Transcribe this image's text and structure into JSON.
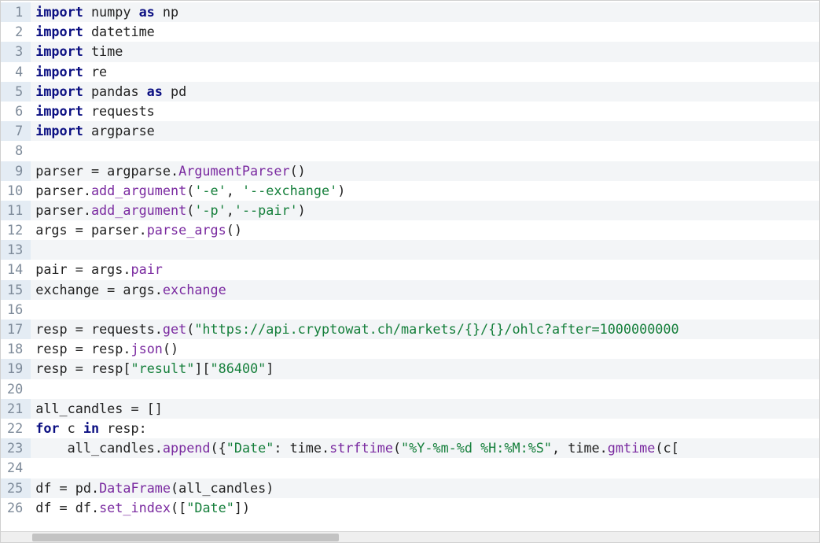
{
  "editor": {
    "lines": [
      {
        "n": 1,
        "tokens": [
          [
            "kw",
            "import"
          ],
          [
            "nm",
            " numpy "
          ],
          [
            "as",
            "as"
          ],
          [
            "nm",
            " np"
          ]
        ]
      },
      {
        "n": 2,
        "tokens": [
          [
            "kw",
            "import"
          ],
          [
            "nm",
            " datetime"
          ]
        ]
      },
      {
        "n": 3,
        "tokens": [
          [
            "kw",
            "import"
          ],
          [
            "nm",
            " time"
          ]
        ]
      },
      {
        "n": 4,
        "tokens": [
          [
            "kw",
            "import"
          ],
          [
            "nm",
            " re"
          ]
        ]
      },
      {
        "n": 5,
        "tokens": [
          [
            "kw",
            "import"
          ],
          [
            "nm",
            " pandas "
          ],
          [
            "as",
            "as"
          ],
          [
            "nm",
            " pd"
          ]
        ]
      },
      {
        "n": 6,
        "tokens": [
          [
            "kw",
            "import"
          ],
          [
            "nm",
            " requests"
          ]
        ]
      },
      {
        "n": 7,
        "tokens": [
          [
            "kw",
            "import"
          ],
          [
            "nm",
            " argparse"
          ]
        ]
      },
      {
        "n": 8,
        "tokens": []
      },
      {
        "n": 9,
        "tokens": [
          [
            "nm",
            "parser "
          ],
          [
            "op",
            "= "
          ],
          [
            "nm",
            "argparse"
          ],
          [
            "op",
            "."
          ],
          [
            "fn",
            "ArgumentParser"
          ],
          [
            "op",
            "()"
          ]
        ]
      },
      {
        "n": 10,
        "tokens": [
          [
            "nm",
            "parser"
          ],
          [
            "op",
            "."
          ],
          [
            "fn",
            "add_argument"
          ],
          [
            "op",
            "("
          ],
          [
            "str",
            "'-e'"
          ],
          [
            "op",
            ", "
          ],
          [
            "str",
            "'--exchange'"
          ],
          [
            "op",
            ")"
          ]
        ]
      },
      {
        "n": 11,
        "tokens": [
          [
            "nm",
            "parser"
          ],
          [
            "op",
            "."
          ],
          [
            "fn",
            "add_argument"
          ],
          [
            "op",
            "("
          ],
          [
            "str",
            "'-p'"
          ],
          [
            "op",
            ","
          ],
          [
            "str",
            "'--pair'"
          ],
          [
            "op",
            ")"
          ]
        ]
      },
      {
        "n": 12,
        "tokens": [
          [
            "nm",
            "args "
          ],
          [
            "op",
            "= "
          ],
          [
            "nm",
            "parser"
          ],
          [
            "op",
            "."
          ],
          [
            "fn",
            "parse_args"
          ],
          [
            "op",
            "()"
          ]
        ]
      },
      {
        "n": 13,
        "tokens": []
      },
      {
        "n": 14,
        "tokens": [
          [
            "nm",
            "pair "
          ],
          [
            "op",
            "= "
          ],
          [
            "nm",
            "args"
          ],
          [
            "op",
            "."
          ],
          [
            "fn",
            "pair"
          ]
        ]
      },
      {
        "n": 15,
        "tokens": [
          [
            "nm",
            "exchange "
          ],
          [
            "op",
            "= "
          ],
          [
            "nm",
            "args"
          ],
          [
            "op",
            "."
          ],
          [
            "fn",
            "exchange"
          ]
        ]
      },
      {
        "n": 16,
        "tokens": []
      },
      {
        "n": 17,
        "tokens": [
          [
            "nm",
            "resp "
          ],
          [
            "op",
            "= "
          ],
          [
            "nm",
            "requests"
          ],
          [
            "op",
            "."
          ],
          [
            "fn",
            "get"
          ],
          [
            "op",
            "("
          ],
          [
            "str",
            "\"https://api.cryptowat.ch/markets/{}/{}/ohlc?after=1000000000"
          ]
        ]
      },
      {
        "n": 18,
        "tokens": [
          [
            "nm",
            "resp "
          ],
          [
            "op",
            "= "
          ],
          [
            "nm",
            "resp"
          ],
          [
            "op",
            "."
          ],
          [
            "fn",
            "json"
          ],
          [
            "op",
            "()"
          ]
        ]
      },
      {
        "n": 19,
        "tokens": [
          [
            "nm",
            "resp "
          ],
          [
            "op",
            "= "
          ],
          [
            "nm",
            "resp"
          ],
          [
            "op",
            "["
          ],
          [
            "str",
            "\"result\""
          ],
          [
            "op",
            "]["
          ],
          [
            "str",
            "\"86400\""
          ],
          [
            "op",
            "]"
          ]
        ]
      },
      {
        "n": 20,
        "tokens": []
      },
      {
        "n": 21,
        "tokens": [
          [
            "nm",
            "all_candles "
          ],
          [
            "op",
            "= []"
          ]
        ]
      },
      {
        "n": 22,
        "tokens": [
          [
            "kw",
            "for"
          ],
          [
            "nm",
            " c "
          ],
          [
            "kw",
            "in"
          ],
          [
            "nm",
            " resp"
          ],
          [
            "op",
            ":"
          ]
        ]
      },
      {
        "n": 23,
        "tokens": [
          [
            "nm",
            "    all_candles"
          ],
          [
            "op",
            "."
          ],
          [
            "fn",
            "append"
          ],
          [
            "op",
            "({"
          ],
          [
            "str",
            "\"Date\""
          ],
          [
            "op",
            ": "
          ],
          [
            "nm",
            "time"
          ],
          [
            "op",
            "."
          ],
          [
            "fn",
            "strftime"
          ],
          [
            "op",
            "("
          ],
          [
            "str",
            "\"%Y-%m-%d %H:%M:%S\""
          ],
          [
            "op",
            ", "
          ],
          [
            "nm",
            "time"
          ],
          [
            "op",
            "."
          ],
          [
            "fn",
            "gmtime"
          ],
          [
            "op",
            "("
          ],
          [
            "nm",
            "c"
          ],
          [
            "op",
            "["
          ]
        ]
      },
      {
        "n": 24,
        "tokens": []
      },
      {
        "n": 25,
        "tokens": [
          [
            "nm",
            "df "
          ],
          [
            "op",
            "= "
          ],
          [
            "nm",
            "pd"
          ],
          [
            "op",
            "."
          ],
          [
            "fn",
            "DataFrame"
          ],
          [
            "op",
            "("
          ],
          [
            "nm",
            "all_candles"
          ],
          [
            "op",
            ")"
          ]
        ]
      },
      {
        "n": 26,
        "tokens": [
          [
            "nm",
            "df "
          ],
          [
            "op",
            "= "
          ],
          [
            "nm",
            "df"
          ],
          [
            "op",
            "."
          ],
          [
            "fn",
            "set_index"
          ],
          [
            "op",
            "(["
          ],
          [
            "str",
            "\"Date\""
          ],
          [
            "op",
            "])"
          ]
        ]
      }
    ]
  }
}
